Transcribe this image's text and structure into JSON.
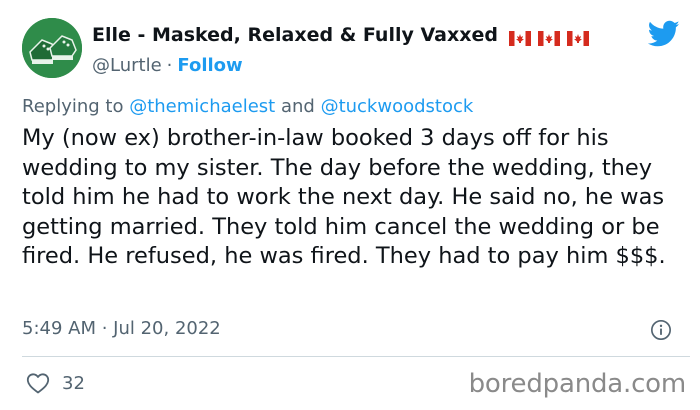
{
  "author": {
    "display_name": "Elle - Masked, Relaxed & Fully Vaxxed",
    "flags": [
      "canada-flag",
      "canada-flag",
      "canada-flag"
    ],
    "handle": "@Lurtle",
    "separator": "·",
    "follow_label": "Follow"
  },
  "reply": {
    "prefix": "Replying to",
    "mention_1": "@themichaelest",
    "conjunction": "and",
    "mention_2": "@tuckwoodstock"
  },
  "tweet": {
    "text": "My (now ex) brother-in-law booked 3 days off for his wedding to my sister. The day before the wedding, they told him he had to work the next day. He said no, he was getting married. They told him cancel the wedding or be fired. He refused, he was fired. They had to pay him $$$.",
    "timestamp": "5:49 AM · Jul 20, 2022"
  },
  "engagement": {
    "like_count": "32"
  },
  "watermark": "boredpanda.com",
  "colors": {
    "link_blue": "#1d9bf0",
    "muted_gray": "#536471",
    "text": "#0f1419",
    "flag_red": "#d52b1e"
  },
  "icons": {
    "brand": "twitter-bird-icon",
    "info": "info-icon",
    "like": "heart-icon"
  }
}
